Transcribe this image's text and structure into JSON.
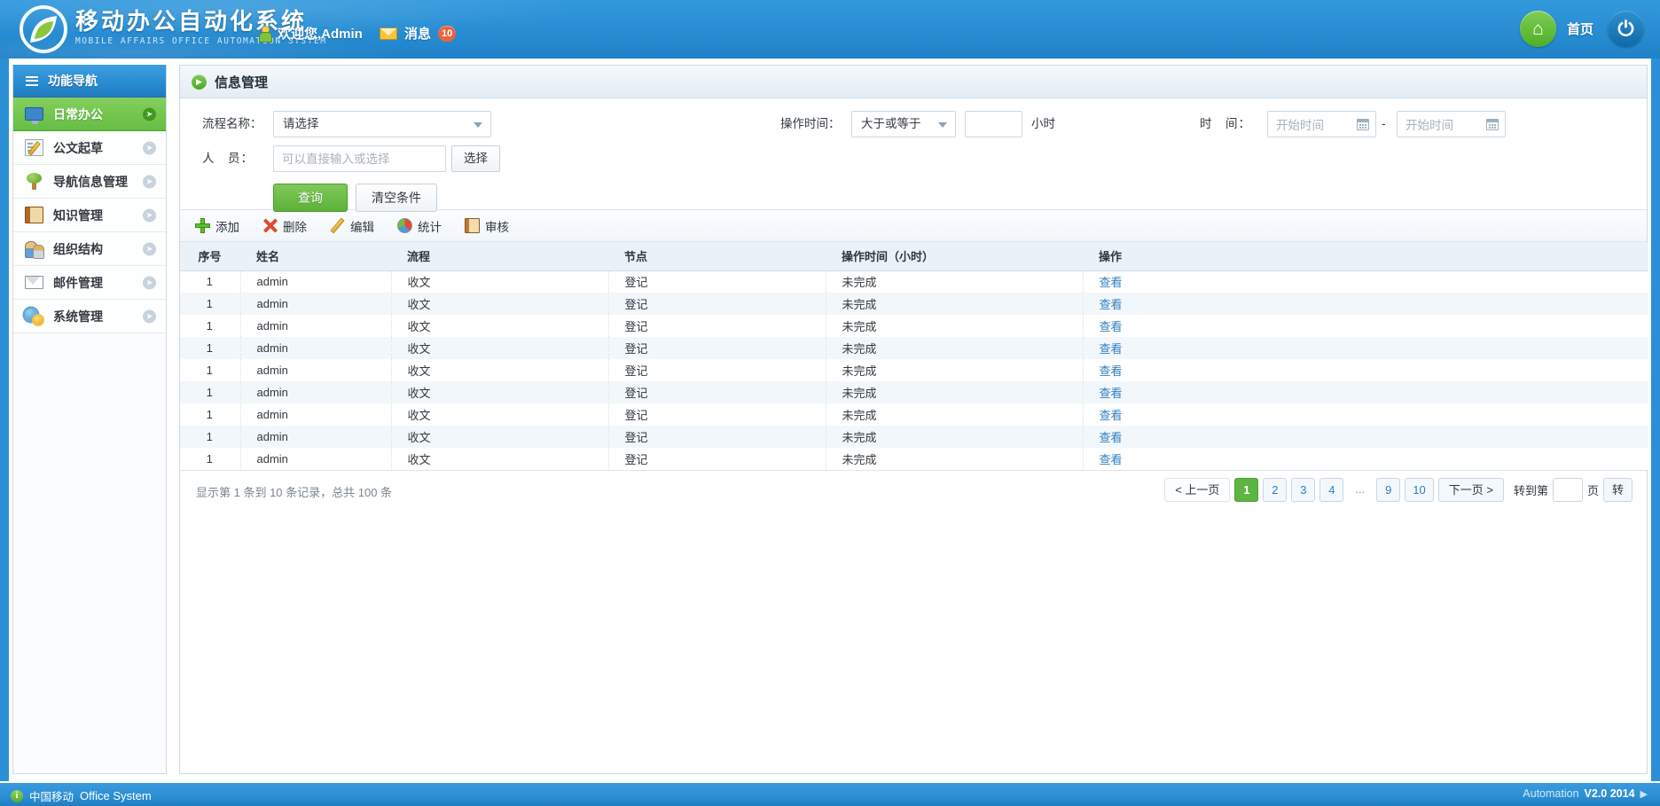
{
  "header": {
    "brand_cn": "移动办公自动化系统",
    "brand_en": "MOBILE AFFAIRS OFFICE AUTOMATION SYSTEM",
    "logo_icon": "swoosh-logo-icon",
    "user_icon": "person-icon",
    "welcome": "欢迎您,Admin",
    "message_icon": "envelope-icon",
    "message_label": "消息",
    "message_count": "10",
    "home_icon": "home-icon",
    "home_label": "首页",
    "power_icon": "power-icon"
  },
  "sidebar": {
    "title": "功能导航",
    "menu_icon": "hamburger-icon",
    "items": [
      {
        "label": "日常办公",
        "icon": "monitor-icon",
        "active": true
      },
      {
        "label": "公文起草",
        "icon": "document-pencil-icon",
        "active": false
      },
      {
        "label": "导航信息管理",
        "icon": "tree-icon",
        "active": false
      },
      {
        "label": "知识管理",
        "icon": "book-icon",
        "active": false
      },
      {
        "label": "组织结构",
        "icon": "users-icon",
        "active": false
      },
      {
        "label": "邮件管理",
        "icon": "mail-icon",
        "active": false
      },
      {
        "label": "系统管理",
        "icon": "gears-icon",
        "active": false
      }
    ]
  },
  "panel": {
    "title": "信息管理",
    "title_bullet_icon": "play-circle-icon"
  },
  "filter": {
    "process_label": "流程名称：",
    "process_value": "请选择",
    "process_caret_icon": "chevron-down-icon",
    "optime_label": "操作时间：",
    "optime_op_value": "大于或等于",
    "optime_hours_value": "",
    "optime_unit": "小时",
    "time_label": "时　间：",
    "time_start_placeholder": "开始时间",
    "time_end_placeholder": "开始时间",
    "time_separator": "-",
    "calendar_icon": "calendar-icon",
    "person_label": "人　员：",
    "person_placeholder": "可以直接输入或选择",
    "person_value": "",
    "person_select_btn": "选择",
    "search_btn": "查询",
    "reset_btn": "清空条件"
  },
  "toolbar": [
    {
      "label": "添加",
      "icon": "plus-icon"
    },
    {
      "label": "删除",
      "icon": "cross-icon"
    },
    {
      "label": "编辑",
      "icon": "pencil-icon"
    },
    {
      "label": "统计",
      "icon": "pie-chart-icon"
    },
    {
      "label": "审核",
      "icon": "notebook-icon"
    }
  ],
  "table": {
    "columns": [
      "序号",
      "姓名",
      "流程",
      "节点",
      "操作时间（小时）",
      "操作"
    ],
    "rows": [
      {
        "seq": "1",
        "name": "admin",
        "process": "收文",
        "node": "登记",
        "optime": "未完成",
        "action": "查看"
      },
      {
        "seq": "1",
        "name": "admin",
        "process": "收文",
        "node": "登记",
        "optime": "未完成",
        "action": "查看"
      },
      {
        "seq": "1",
        "name": "admin",
        "process": "收文",
        "node": "登记",
        "optime": "未完成",
        "action": "查看"
      },
      {
        "seq": "1",
        "name": "admin",
        "process": "收文",
        "node": "登记",
        "optime": "未完成",
        "action": "查看"
      },
      {
        "seq": "1",
        "name": "admin",
        "process": "收文",
        "node": "登记",
        "optime": "未完成",
        "action": "查看"
      },
      {
        "seq": "1",
        "name": "admin",
        "process": "收文",
        "node": "登记",
        "optime": "未完成",
        "action": "查看"
      },
      {
        "seq": "1",
        "name": "admin",
        "process": "收文",
        "node": "登记",
        "optime": "未完成",
        "action": "查看"
      },
      {
        "seq": "1",
        "name": "admin",
        "process": "收文",
        "node": "登记",
        "optime": "未完成",
        "action": "查看"
      },
      {
        "seq": "1",
        "name": "admin",
        "process": "收文",
        "node": "登记",
        "optime": "未完成",
        "action": "查看"
      }
    ]
  },
  "pagination": {
    "record_info": "显示第 1 条到 10 条记录，总共 100 条",
    "prev_label": "< 上一页",
    "next_label": "下一页 >",
    "pages": [
      "1",
      "2",
      "3",
      "4",
      "...",
      "9",
      "10"
    ],
    "active_page": "1",
    "goto_prefix": "转到第",
    "goto_value": "",
    "goto_suffix": "页",
    "goto_btn": "转"
  },
  "footer": {
    "info_icon": "info-icon",
    "left_cn": "中国移动",
    "left_en": "Office System",
    "right_product": "Automation",
    "right_version": "V2.0 2014",
    "right_arrow_icon": "chevron-right-icon"
  },
  "colors": {
    "header_blue": "#2a8fd4",
    "accent_green": "#5cb542",
    "link_blue": "#2f7fc0",
    "badge_red": "#e8643c",
    "panel_header": "#eaf1f7"
  }
}
